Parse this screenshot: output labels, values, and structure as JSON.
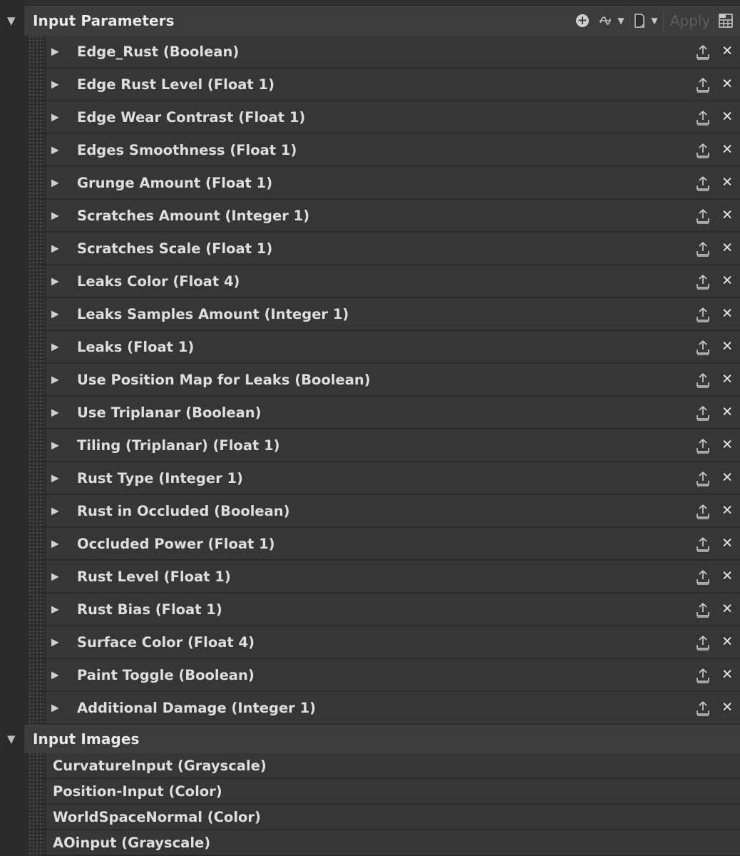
{
  "input_parameters": {
    "title": "Input Parameters",
    "toolbar": {
      "apply_label": "Apply"
    },
    "items": [
      {
        "label": "Edge_Rust (Boolean)"
      },
      {
        "label": "Edge Rust Level (Float 1)"
      },
      {
        "label": "Edge Wear Contrast (Float 1)"
      },
      {
        "label": "Edges Smoothness (Float 1)"
      },
      {
        "label": "Grunge Amount (Float 1)"
      },
      {
        "label": "Scratches Amount (Integer 1)"
      },
      {
        "label": "Scratches Scale (Float 1)"
      },
      {
        "label": "Leaks Color (Float 4)"
      },
      {
        "label": "Leaks Samples Amount (Integer 1)"
      },
      {
        "label": "Leaks (Float 1)"
      },
      {
        "label": "Use Position Map for Leaks (Boolean)"
      },
      {
        "label": "Use Triplanar (Boolean)"
      },
      {
        "label": "Tiling (Triplanar) (Float 1)"
      },
      {
        "label": "Rust Type (Integer 1)"
      },
      {
        "label": "Rust in Occluded (Boolean)"
      },
      {
        "label": "Occluded Power (Float 1)"
      },
      {
        "label": "Rust Level (Float 1)"
      },
      {
        "label": "Rust Bias (Float 1)"
      },
      {
        "label": "Surface Color (Float 4)"
      },
      {
        "label": "Paint Toggle (Boolean)"
      },
      {
        "label": "Additional Damage (Integer 1)"
      }
    ]
  },
  "input_images": {
    "title": "Input Images",
    "items": [
      {
        "label": "CurvatureInput (Grayscale)"
      },
      {
        "label": "Position-Input (Color)"
      },
      {
        "label": "WorldSpaceNormal (Color)"
      },
      {
        "label": "AOinput (Grayscale)"
      }
    ]
  },
  "colors": {
    "background": "#2a2a2a",
    "header_band": "#3c3c3c",
    "row": "#363636",
    "text": "#dedede",
    "disabled_text": "#5e5e5e"
  }
}
